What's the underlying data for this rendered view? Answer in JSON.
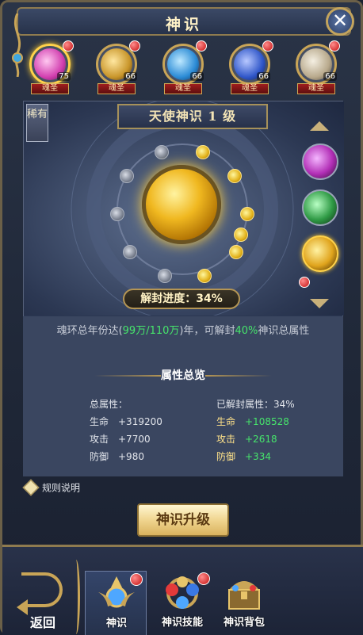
{
  "window": {
    "title": "神识",
    "close_icon": "close-icon"
  },
  "avatars": [
    {
      "level": "75",
      "tag": "魂圣",
      "selected": true,
      "color": "#d23fb0"
    },
    {
      "level": "66",
      "tag": "魂圣",
      "selected": false,
      "color": "#c9962b"
    },
    {
      "level": "66",
      "tag": "魂圣",
      "selected": false,
      "color": "#2c8cd6"
    },
    {
      "level": "66",
      "tag": "魂圣",
      "selected": false,
      "color": "#3057c9"
    },
    {
      "level": "66",
      "tag": "魂圣",
      "selected": false,
      "color": "#b8a98c"
    }
  ],
  "scene": {
    "rarity": "稀有",
    "level_title": "天使神识 1 级",
    "progress_label": "解封进度：34%",
    "lit_slots": 6,
    "total_slots": 12
  },
  "side_items": [
    {
      "name": "purple-spirit",
      "color": "#b22fb6",
      "selected": false
    },
    {
      "name": "green-spirit",
      "color": "#2f9a45",
      "selected": false
    },
    {
      "name": "gold-spirit",
      "color": "#e0a41c",
      "selected": true
    }
  ],
  "info": {
    "desc_prefix": "魂环总年份达(",
    "desc_hi1": "99万/110万",
    "desc_mid": ")年，可解封",
    "desc_hi2": "40%",
    "desc_suffix": "神识总属性",
    "summary_title": "属性总览",
    "total_label": "总属性：",
    "unlocked_label": "已解封属性：34%",
    "total_stats": [
      {
        "key": "生命",
        "value": "+319200"
      },
      {
        "key": "攻击",
        "value": "+7700"
      },
      {
        "key": "防御",
        "value": "+980"
      }
    ],
    "unlocked_stats": [
      {
        "key": "生命",
        "value": "+108528"
      },
      {
        "key": "攻击",
        "value": "+2618"
      },
      {
        "key": "防御",
        "value": "+334"
      }
    ]
  },
  "rules_label": "规则说明",
  "upgrade_label": "神识升级",
  "bottom": {
    "back_label": "返回",
    "tabs": [
      {
        "label": "神识",
        "active": true,
        "badge": true
      },
      {
        "label": "神识技能",
        "active": false,
        "badge": true
      },
      {
        "label": "神识背包",
        "active": false,
        "badge": false
      }
    ]
  }
}
